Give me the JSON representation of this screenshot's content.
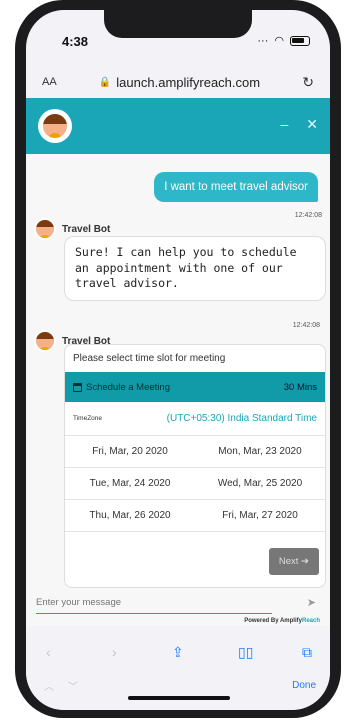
{
  "status": {
    "time": "4:38"
  },
  "browser": {
    "aa_label": "AA",
    "url": "launch.amplifyreach.com"
  },
  "colors": {
    "accent": "#1aa6b7",
    "user_bubble": "#2eb7c8",
    "header": "#1aa6b7"
  },
  "chat": {
    "user_message": "I want to meet travel advisor",
    "user_time": "12:42:08",
    "bot_name_1": "Travel Bot",
    "bot_message": "Sure! I can help you to schedule an appointment with one of our travel advisor.",
    "bot_time": "12:42:08",
    "bot_name_2": "Travel Bot"
  },
  "card": {
    "title": "Please select time slot for meeting",
    "schedule_label": "Schedule a Meeting",
    "duration": "30 Mins",
    "timezone_label": "TimeZone",
    "timezone_value": "(UTC+05:30) India Standard Time",
    "slots": [
      [
        "Fri, Mar, 20 2020",
        "Mon, Mar, 23 2020"
      ],
      [
        "Tue, Mar, 24 2020",
        "Wed, Mar, 25 2020"
      ],
      [
        "Thu, Mar, 26 2020",
        "Fri, Mar, 27 2020"
      ]
    ],
    "next_label": "Next ➔"
  },
  "composer": {
    "placeholder": "Enter your message"
  },
  "footer": {
    "powered_prefix": "Powered By Amplify",
    "powered_brand": "Reach"
  },
  "toolbar": {
    "done_label": "Done"
  }
}
